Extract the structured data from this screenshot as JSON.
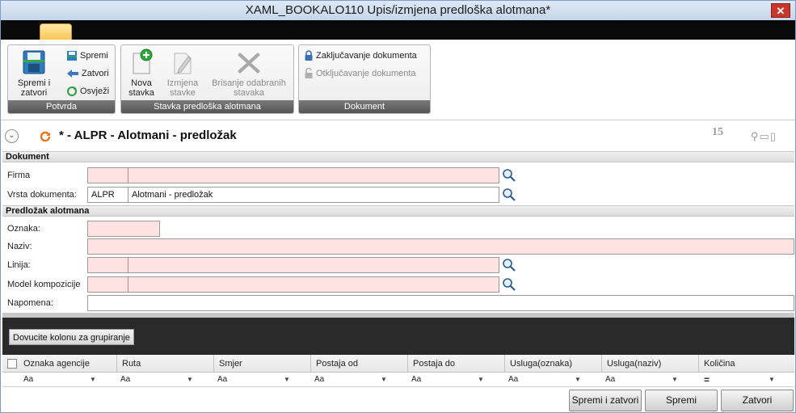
{
  "window": {
    "title": "XAML_BOOKALO110  Upis/izmjena predloška alotmana*",
    "close_label": "✕"
  },
  "ribbon": {
    "groups": [
      {
        "title": "Potvrda"
      },
      {
        "title": "Stavka predloška alotmana"
      },
      {
        "title": "Dokument"
      }
    ],
    "save_close": {
      "line1": "Spremi i",
      "line2": "zatvori"
    },
    "save": "Spremi",
    "close": "Zatvori",
    "refresh": "Osvježi",
    "new_item": {
      "line1": "Nova",
      "line2": "stavka"
    },
    "edit_item": {
      "line1": "Izmjena",
      "line2": "stavke"
    },
    "delete_items": {
      "line1": "Brisanje odabranih",
      "line2": "stavaka"
    },
    "lock_doc": "Zaključavanje dokumenta",
    "unlock_doc": "Otključavanje dokumenta"
  },
  "header": {
    "title": "* - ALPR - Alotmani - predložak",
    "number": "15"
  },
  "sections": {
    "document": "Dokument",
    "template": "Predložak alotmana"
  },
  "form": {
    "firma_label": "Firma",
    "vrsta_label": "Vrsta dokumenta:",
    "vrsta_code": "ALPR",
    "vrsta_name": "Alotmani - predložak",
    "oznaka_label": "Oznaka:",
    "naziv_label": "Naziv:",
    "linija_label": "Linija:",
    "model_label": "Model kompozicije",
    "napomena_label": "Napomena:"
  },
  "grid": {
    "group_hint": "Dovucite kolonu za grupiranje",
    "columns": [
      "Oznaka agencije",
      "Ruta",
      "Smjer",
      "Postaja od",
      "Postaja do",
      "Usluga(oznaka)",
      "Usluga(naziv)",
      "Količina"
    ],
    "filters": [
      "Aa",
      "Aa",
      "Aa",
      "Aa",
      "Aa",
      "Aa",
      "Aa",
      "="
    ]
  },
  "buttons": {
    "save_close": "Spremi i zatvori",
    "save": "Spremi",
    "close": "Zatvori"
  },
  "colors": {
    "required_field": "#ffe3e3",
    "accent": "#f6c349"
  }
}
